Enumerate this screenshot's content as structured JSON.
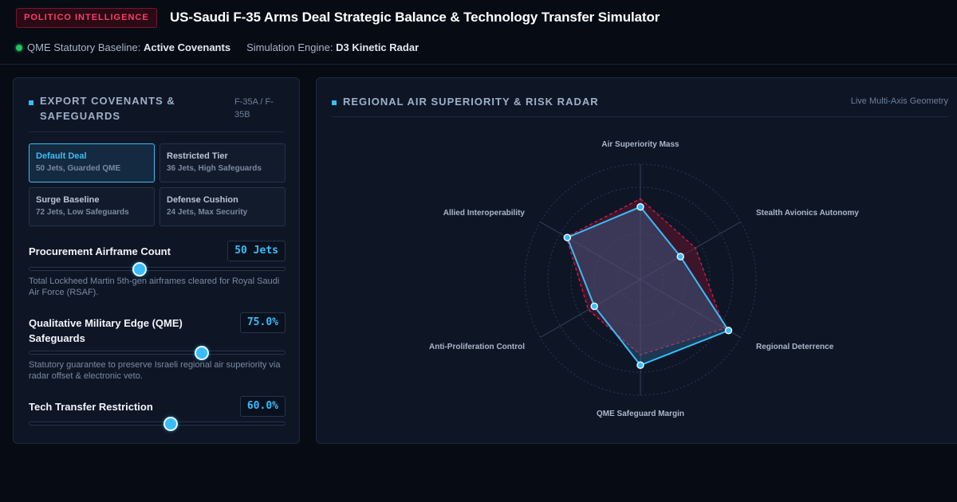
{
  "header": {
    "badge": "POLITICO INTELLIGENCE",
    "title": "US-Saudi F-35 Arms Deal Strategic Balance & Technology Transfer Simulator",
    "status_items": [
      {
        "label": "QME Statutory Baseline:",
        "value": "Active Covenants"
      },
      {
        "label": "Simulation Engine:",
        "value": "D3 Kinetic Radar"
      }
    ],
    "status_color": "#22c55e"
  },
  "left_panel": {
    "title": "EXPORT COVENANTS & SAFEGUARDS",
    "subtitle": "F-35A / F-35B",
    "presets": [
      {
        "name": "Default Deal",
        "desc": "50 Jets, Guarded QME",
        "active": true
      },
      {
        "name": "Restricted Tier",
        "desc": "36 Jets, High Safeguards",
        "active": false
      },
      {
        "name": "Surge Baseline",
        "desc": "72 Jets, Low Safeguards",
        "active": false
      },
      {
        "name": "Defense Cushion",
        "desc": "24 Jets, Max Security",
        "active": false
      }
    ],
    "controls": [
      {
        "label": "Procurement Airframe Count",
        "value_text": "50 Jets",
        "fraction": 0.43,
        "desc": "Total Lockheed Martin 5th-gen airframes cleared for Royal Saudi Air Force (RSAF)."
      },
      {
        "label": "Qualitative Military Edge (QME) Safeguards",
        "value_text": "75.0%",
        "fraction": 0.67,
        "desc": "Statutory guarantee to preserve Israeli regional air superiority via radar offset & electronic veto."
      },
      {
        "label": "Tech Transfer Restriction",
        "value_text": "60.0%",
        "fraction": 0.55,
        "desc": ""
      }
    ]
  },
  "right_panel": {
    "title": "REGIONAL AIR SUPERIORITY & RISK RADAR",
    "subtitle": "Live Multi-Axis Geometry"
  },
  "chart_data": {
    "type": "radar",
    "axes": [
      "Air Superiority Mass",
      "Stealth Avionics Autonomy",
      "Regional Deterrence",
      "QME Safeguard Margin",
      "Anti-Proliferation Control",
      "Allied Interoperability"
    ],
    "range": [
      0,
      1
    ],
    "series": [
      {
        "values": [
          0.63,
          0.4,
          0.88,
          0.74,
          0.46,
          0.73
        ],
        "color": "#38bdf8",
        "style": "solid"
      },
      {
        "values": [
          0.7,
          0.55,
          0.84,
          0.65,
          0.52,
          0.74
        ],
        "color": "#e11d48",
        "style": "dashed"
      }
    ],
    "rings": 5,
    "grid": true
  },
  "colors": {
    "accent": "#38bdf8",
    "alert": "#ff3b6b"
  }
}
